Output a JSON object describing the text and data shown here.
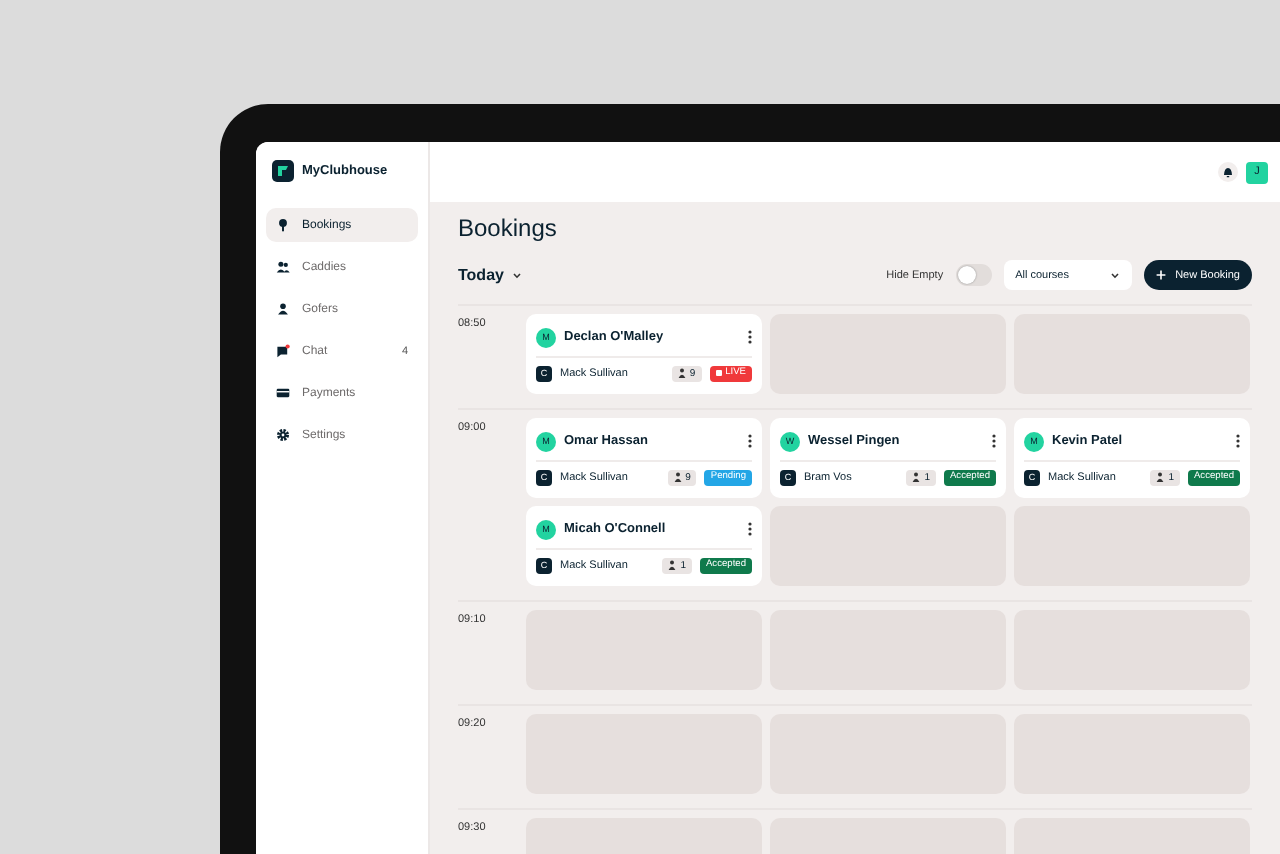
{
  "app": {
    "name": "MyClubhouse"
  },
  "sidebar": {
    "items": [
      {
        "label": "Bookings",
        "selected": true
      },
      {
        "label": "Caddies",
        "selected": false
      },
      {
        "label": "Gofers",
        "selected": false
      },
      {
        "label": "Chat",
        "selected": false,
        "badge": "4"
      },
      {
        "label": "Payments",
        "selected": false
      },
      {
        "label": "Settings",
        "selected": false
      }
    ]
  },
  "header": {
    "avatar": "J"
  },
  "page": {
    "title": "Bookings",
    "date_filter": "Today",
    "hide_empty": {
      "label": "Hide Empty",
      "on": false
    },
    "course_select": "All courses",
    "new_button": "New Booking"
  },
  "rows": [
    {
      "time": "08:50",
      "slots": [
        {
          "kind": "booking",
          "avatar": "M",
          "name": "Declan O'Malley",
          "caddie_initial": "C",
          "caddie": "Mack Sullivan",
          "players": "9",
          "status": {
            "kind": "live",
            "label": "LIVE"
          }
        },
        {
          "kind": "empty"
        },
        {
          "kind": "empty"
        }
      ]
    },
    {
      "time": "09:00",
      "slots": [
        {
          "kind": "booking",
          "avatar": "M",
          "name": "Omar Hassan",
          "caddie_initial": "C",
          "caddie": "Mack Sullivan",
          "players": "9",
          "status": {
            "kind": "pending",
            "label": "Pending"
          }
        },
        {
          "kind": "booking",
          "avatar": "W",
          "name": "Wessel Pingen",
          "caddie_initial": "C",
          "caddie": "Bram Vos",
          "players": "1",
          "status": {
            "kind": "accepted",
            "label": "Accepted"
          }
        },
        {
          "kind": "booking",
          "avatar": "M",
          "name": "Kevin Patel",
          "caddie_initial": "C",
          "caddie": "Mack Sullivan",
          "players": "1",
          "status": {
            "kind": "accepted",
            "label": "Accepted"
          }
        },
        {
          "kind": "booking",
          "avatar": "M",
          "name": "Micah O'Connell",
          "caddie_initial": "C",
          "caddie": "Mack Sullivan",
          "players": "1",
          "status": {
            "kind": "accepted",
            "label": "Accepted"
          }
        },
        {
          "kind": "empty"
        },
        {
          "kind": "empty"
        }
      ]
    },
    {
      "time": "09:10",
      "slots": [
        {
          "kind": "empty"
        },
        {
          "kind": "empty"
        },
        {
          "kind": "empty"
        }
      ]
    },
    {
      "time": "09:20",
      "slots": [
        {
          "kind": "empty"
        },
        {
          "kind": "empty"
        },
        {
          "kind": "empty"
        }
      ]
    },
    {
      "time": "09:30",
      "slots": [
        {
          "kind": "empty"
        },
        {
          "kind": "empty"
        },
        {
          "kind": "empty"
        }
      ]
    }
  ]
}
